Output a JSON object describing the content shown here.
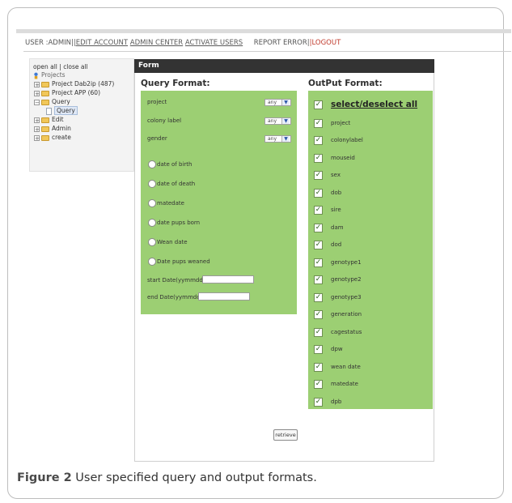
{
  "userbar": {
    "user": "USER :ADMIN|",
    "edit_account": "|EDIT ACCOUNT",
    "admin_center": "ADMIN CENTER",
    "activate_users": "ACTIVATE USERS",
    "report_error": "REPORT ERROR|",
    "logout": "|LOGOUT"
  },
  "tree": {
    "open_all": "open all",
    "separator": "|",
    "close_all": "close all",
    "items": [
      {
        "label": "Projects",
        "level": 0,
        "expander": "",
        "icon": "projects-icon"
      },
      {
        "label": "Project Dab2ip (487)",
        "level": 1,
        "expander": "+",
        "icon": "folder-icon"
      },
      {
        "label": "Project APP (60)",
        "level": 1,
        "expander": "+",
        "icon": "folder-icon"
      },
      {
        "label": "Query",
        "level": 1,
        "expander": "−",
        "icon": "folder-icon"
      },
      {
        "label": "Query",
        "level": 2,
        "expander": "",
        "icon": "page-icon"
      },
      {
        "label": "Edit",
        "level": 1,
        "expander": "+",
        "icon": "folder-icon"
      },
      {
        "label": "Admin",
        "level": 1,
        "expander": "+",
        "icon": "folder-icon"
      },
      {
        "label": "create",
        "level": 1,
        "expander": "+",
        "icon": "folder-icon"
      }
    ]
  },
  "form": {
    "title": "Form",
    "query_title": "Query Format:",
    "output_title": "OutPut Format:",
    "query_selects": [
      {
        "label": "project",
        "value": "any"
      },
      {
        "label": "colony label",
        "value": "any"
      },
      {
        "label": "gender",
        "value": "any"
      }
    ],
    "radio_options": [
      "date of birth",
      "date of death",
      "matedate",
      "date pups born",
      "Wean date",
      "Date pups weaned"
    ],
    "start_date_label": "start Date(yymmdd):",
    "end_date_label": "end Date(yymmdd):",
    "select_all": "select/deselect all",
    "output_fields": [
      "project",
      "colonylabel",
      "mouseid",
      "sex",
      "dob",
      "sire",
      "dam",
      "dod",
      "genotype1",
      "genotype2",
      "genotype3",
      "generation",
      "cagestatus",
      "dpw",
      "wean date",
      "matedate",
      "dpb"
    ],
    "checkmark": "✓",
    "retrieve_label": "retrieve"
  },
  "caption": {
    "prefix": "Figure 2",
    "text": " User specified query and output formats."
  },
  "colors": {
    "panel_green": "#9ccf73",
    "header_dark": "#333333",
    "logout_red": "#c0392b"
  }
}
